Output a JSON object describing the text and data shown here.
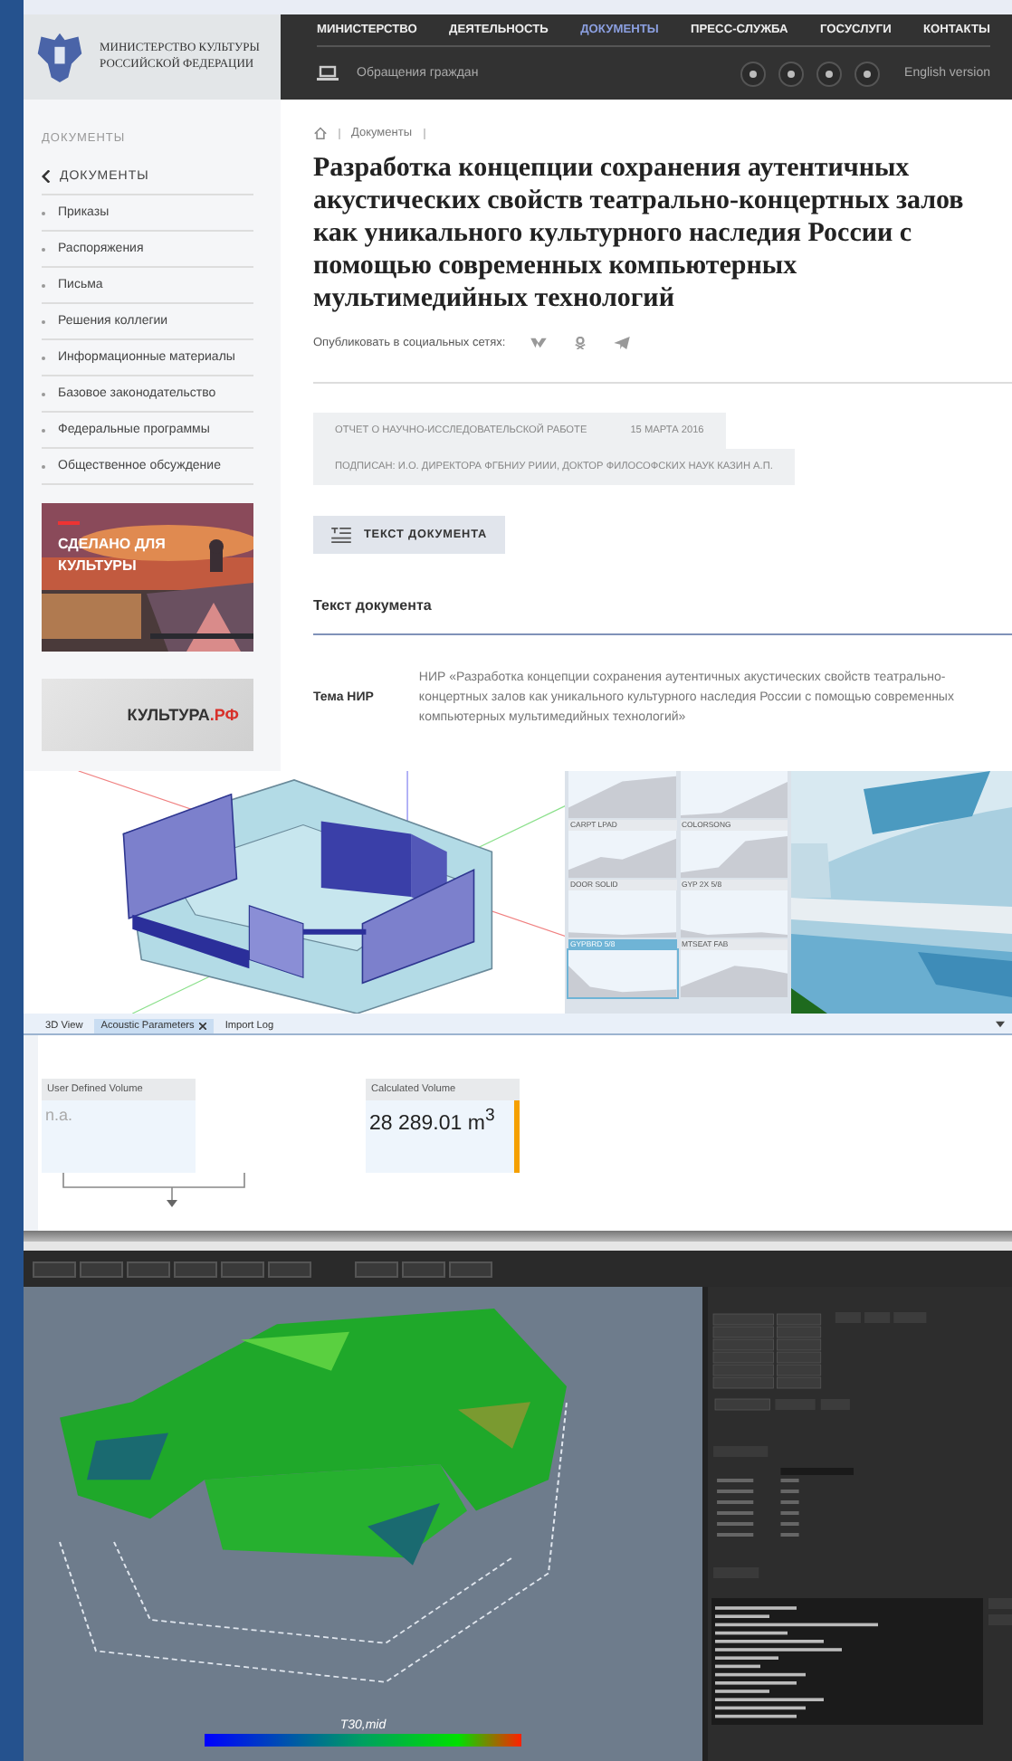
{
  "header": {
    "org": "МИНИСТЕРСТВО КУЛЬТУРЫ РОССИЙСКОЙ ФЕДЕРАЦИИ",
    "nav": [
      {
        "label": "МИНИСТЕРСТВО",
        "selected": false
      },
      {
        "label": "ДЕЯТЕЛЬНОСТЬ",
        "selected": false
      },
      {
        "label": "ДОКУМЕНТЫ",
        "selected": true
      },
      {
        "label": "ПРЕСС-СЛУЖБА",
        "selected": false
      },
      {
        "label": "ГОСУСЛУГИ",
        "selected": false
      },
      {
        "label": "КОНТАКТЫ",
        "selected": false
      }
    ],
    "appeal": "Обращения граждан",
    "english": "English version"
  },
  "sidebar": {
    "heading": "ДОКУМЕНТЫ",
    "back": "ДОКУМЕНТЫ",
    "items": [
      "Приказы",
      "Распоряжения",
      "Письма",
      "Решения коллегии",
      "Информационные материалы",
      "Базовое законодательство",
      "Федеральные программы",
      "Общественное обсуждение"
    ],
    "banner": {
      "kind": "picture",
      "text": "СДЕЛАНО ДЛЯ КУЛЬТУРЫ"
    },
    "brand": {
      "name": "КУЛЬТУРА",
      "suffix": ".РФ"
    }
  },
  "content": {
    "breadcrumb": "Документы",
    "title": "Разработка концепции сохранения аутентичных акустических свойств театрально-концертных залов как уникального культурного наследия России с помощью современных компьютерных мультимедийных технологий",
    "share_label": "Опубликовать в социальных сетях:",
    "tags": [
      "ОТЧЕТ О НАУЧНО-ИССЛЕДОВАТЕЛЬСКОЙ РАБОТЕ",
      "15 МАРТА 2016",
      "ПОДПИСАН: И.О. ДИРЕКТОРА ФГБНИУ РИИИ, ДОКТОР ФИЛОСОФСКИХ НАУК КАЗИН А.П."
    ],
    "button": "ТЕКСТ ДОКУМЕНТА",
    "section": "Текст документа",
    "field_label": "Тема НИР",
    "field_value": "НИР «Разработка концепции сохранения аутентичных акустических свойств театрально-концертных залов как уникального культурного наследия России с помощью современных компьютерных мультимедийных технологий»"
  },
  "materials": [
    {
      "selected": false
    },
    {
      "selected": false
    },
    {
      "label": "CARPT LPAD",
      "selected": false
    },
    {
      "label": "COLORSONG",
      "selected": false
    },
    {
      "label": "DOOR SOLID",
      "selected": false
    },
    {
      "label": "GYP 2X 5/8",
      "selected": false
    },
    {
      "label": "GYPBRD 5/8",
      "selected": true
    },
    {
      "label": "MTSEAT FAB",
      "selected": false
    }
  ],
  "acoustic": {
    "tabs": [
      {
        "label": "3D View",
        "selected": false,
        "closable": false
      },
      {
        "label": "Acoustic Parameters",
        "selected": true,
        "closable": true
      },
      {
        "label": "Import Log",
        "selected": false,
        "closable": false
      }
    ],
    "cards": [
      {
        "title": "User Defined Volume",
        "value": "n.a.",
        "highlighted": false
      },
      {
        "title": "Calculated Volume",
        "value": "28 289.01 m$^{3}$",
        "highlighted": true
      }
    ]
  },
  "viewer": {
    "colorbar_label": "T30,mid"
  }
}
